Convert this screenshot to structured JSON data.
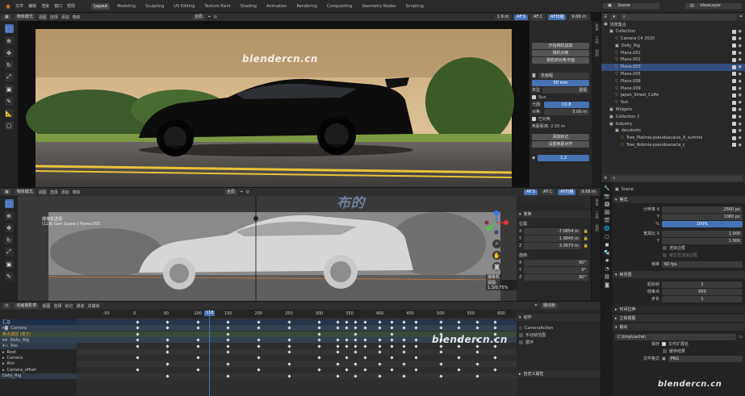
{
  "app": {
    "menus": [
      "文件",
      "编辑",
      "渲染",
      "窗口",
      "帮助"
    ],
    "workspaces": [
      "Layout",
      "Modeling",
      "Sculpting",
      "UV Editing",
      "Texture Paint",
      "Shading",
      "Animation",
      "Rendering",
      "Compositing",
      "Geometry Nodes",
      "Scripting"
    ],
    "active_workspace": "Layout",
    "scene": "Scene",
    "view_layer": "ViewLayer"
  },
  "viewport_top": {
    "mode": "物体模式",
    "menus": [
      "视图",
      "选择",
      "添加",
      "物体"
    ],
    "transform": "全局",
    "render_frame": {
      "l1": "1.9 m",
      "l2": "AF:S",
      "l3": "AF:C",
      "l4": "AF扫描",
      "l5": "9.68 m"
    }
  },
  "camera_tools": {
    "btn1": "开始相机追踪",
    "btn2": "相机对焦",
    "btn3": "相机到对焦平面",
    "btn4": "添加标记",
    "btn5": "设置焦距对齐",
    "sensor_label": "全画幅",
    "focal": "50 mm",
    "type_label": "类型",
    "type_value": "透视",
    "shift_label": "Sun",
    "field_a_label": "光圈:",
    "field_a": "f/2.8",
    "field_b_label": "对焦:",
    "field_b": "5.00 m",
    "check_label": "已对焦",
    "dist_text": "焦距距离: 2.50 m",
    "version": "1.2"
  },
  "viewport_bottom": {
    "mode": "物体模式",
    "menus": [
      "视图",
      "选择",
      "添加",
      "物体"
    ],
    "transform": "全局",
    "overlay_title": "摄像机透视",
    "overlay_sub": "(118) Gen Scene | Plane.003",
    "rf": {
      "l1": "AF:S",
      "l2": "AF:C",
      "l3": "AF扫描",
      "l4": "9.68 m"
    }
  },
  "n_panel": {
    "section": "变换",
    "loc_label": "位置:",
    "x_label": "X",
    "x_value": "-7.0854 m",
    "y_label": "Y",
    "y_value": "1.9849 m",
    "z_label": "Z",
    "z_value": "3.0673 m",
    "rot_label": "旋转:",
    "rx": "90°",
    "ry": "0°",
    "rz": "90°",
    "tooltip_title": "摄像机",
    "tooltip_sub": "视图: 1.3/0.75%"
  },
  "outliner": {
    "header": "场景集合",
    "items": [
      {
        "label": "Collection",
        "indent": 1,
        "color": "#cfcfcf"
      },
      {
        "label": "Camera C4 2020",
        "indent": 2,
        "color": "#e09a4a"
      },
      {
        "label": "Dolly_Rig",
        "indent": 2,
        "color": "#cfcfcf"
      },
      {
        "label": "Plane.001",
        "indent": 2,
        "color": "#e09a4a"
      },
      {
        "label": "Plane.002",
        "indent": 2,
        "color": "#e09a4a"
      },
      {
        "label": "Plane.003",
        "indent": 2,
        "color": "#e09a4a",
        "selected": true
      },
      {
        "label": "Plane.005",
        "indent": 2,
        "color": "#e09a4a"
      },
      {
        "label": "Plane.006",
        "indent": 2,
        "color": "#e09a4a"
      },
      {
        "label": "Plane.009",
        "indent": 2,
        "color": "#e09a4a"
      },
      {
        "label": "Japan_Street_Coffe",
        "indent": 2,
        "color": "#e09a4a"
      },
      {
        "label": "Sun",
        "indent": 2,
        "color": "#e09a4a"
      },
      {
        "label": "Widgets",
        "indent": 1,
        "color": "#cfcfcf"
      },
      {
        "label": "Collection 2",
        "indent": 1,
        "color": "#cfcfcf"
      },
      {
        "label": "Industry",
        "indent": 1,
        "color": "#cfcfcf"
      },
      {
        "label": "decoloots",
        "indent": 2,
        "color": "#cfcfcf"
      },
      {
        "label": "Tree_Platinia-pseudoacacia_A_summe",
        "indent": 3,
        "color": "#e09a4a"
      },
      {
        "label": "Tree_Robinia-pseudoacacia_c",
        "indent": 3,
        "color": "#e09a4a"
      }
    ]
  },
  "props": {
    "scene_name": "Scene",
    "format_label": "格式",
    "res_x_label": "分辨率 X",
    "res_x": "2560 px",
    "res_y_label": "Y",
    "res_y": "1080 px",
    "pct_label": "%",
    "pct": "100%",
    "aspect_x_label": "宽高比 X",
    "aspect_x": "1.000",
    "aspect_y_label": "Y",
    "aspect_y": "1.000",
    "border_label": "渲染边框",
    "crop_label": "裁剪至渲染边框",
    "fps_label": "帧率",
    "fps": "60 fps",
    "frame_range": "帧范围",
    "start_label": "起始帧",
    "start": "1",
    "end_label": "结束点",
    "end": "600",
    "step_label": "步长",
    "step": "1",
    "time_stretch": "时间拉伸",
    "stereo": "立体视图",
    "output": "输出",
    "path": "C:\\tmp\\cache\\",
    "save_label": "保存",
    "ext_label": "文件扩展名",
    "cache_label": "缓存结果",
    "format2_label": "文件格式",
    "format2": "PNG"
  },
  "dopesheet": {
    "mode": "动画摄影表",
    "menus": [
      "视图",
      "选择",
      "标记",
      "通道",
      "关键帧"
    ],
    "action_label": "摄动帧",
    "current_frame": "118",
    "ticks": [
      -50,
      0,
      50,
      100,
      150,
      200,
      250,
      300,
      350,
      400,
      450,
      500,
      550,
      600
    ],
    "rows": [
      {
        "label": "汇总",
        "kind": "summary"
      },
      {
        "label": "Camera",
        "kind": "obj"
      },
      {
        "label": "焦点调控 (修正)",
        "kind": "action"
      },
      {
        "label": "Dolly_Rig",
        "kind": "obj"
      },
      {
        "label": "Pos",
        "kind": "group"
      },
      {
        "label": "Root",
        "kind": "channel"
      },
      {
        "label": "Camera",
        "kind": "channel"
      },
      {
        "label": "Aim",
        "kind": "channel"
      },
      {
        "label": "Camera_offset",
        "kind": "channel"
      },
      {
        "label": "Dolly_Rig",
        "kind": "channel"
      }
    ],
    "side": {
      "section": "动作",
      "action_name": "CameraAction",
      "manual_range": "手动帧范围",
      "cycle": "循环",
      "custom": "自定义属性"
    }
  },
  "watermarks": [
    "blendercn.cn",
    "blendercn.cn",
    "blendercn.cn",
    "布的"
  ]
}
